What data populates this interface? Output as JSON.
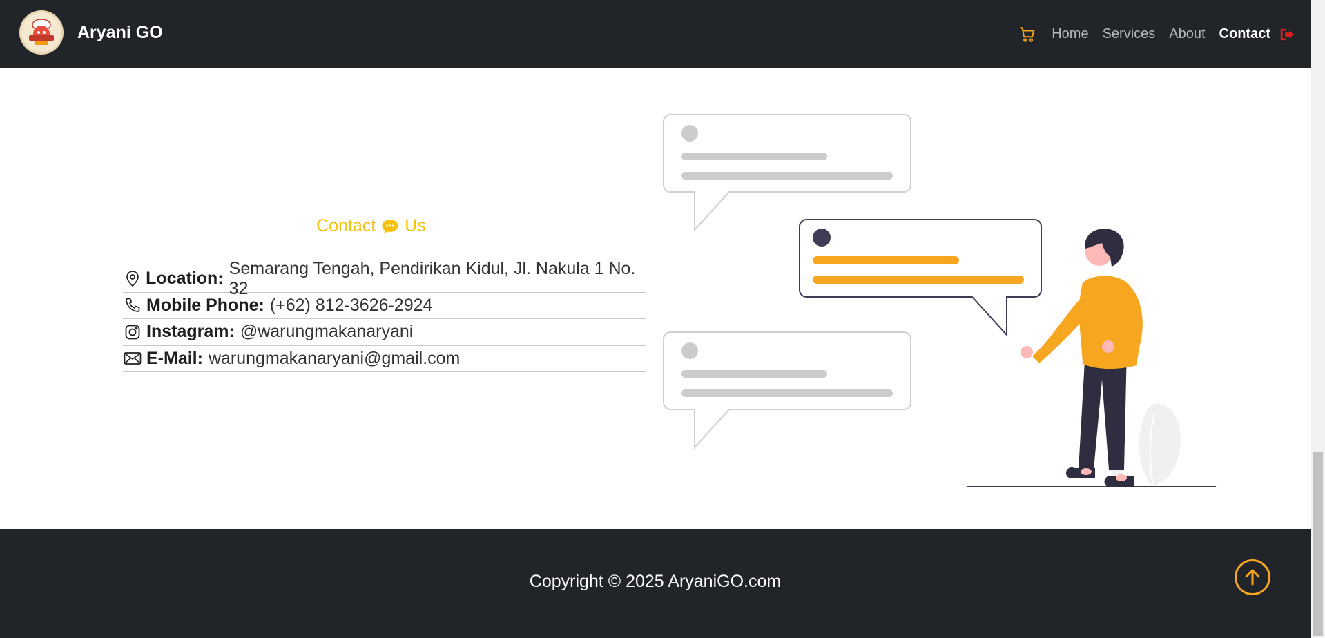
{
  "navbar": {
    "brand": "Aryani GO",
    "links": [
      {
        "label": "Home",
        "active": false
      },
      {
        "label": "Services",
        "active": false
      },
      {
        "label": "About",
        "active": false
      },
      {
        "label": "Contact",
        "active": true
      }
    ],
    "cart_icon": "shopping-cart-icon",
    "logout_icon": "sign-out-icon"
  },
  "contact": {
    "title_part1": "Contact",
    "title_icon": "speech-bubble-icon",
    "title_part2": "Us",
    "items": [
      {
        "icon": "map-pin-icon",
        "label": "Location:",
        "value": "Semarang Tengah, Pendirikan Kidul, Jl. Nakula 1 No. 32"
      },
      {
        "icon": "phone-icon",
        "label": "Mobile Phone:",
        "value": "(+62) 812-3626-2924"
      },
      {
        "icon": "instagram-icon",
        "label": "Instagram:",
        "value": "@warungmakanaryani"
      },
      {
        "icon": "envelope-icon",
        "label": "E-Mail:",
        "value": "warungmakanaryani@gmail.com"
      }
    ]
  },
  "footer": {
    "copyright": "Copyright © 2025 AryaniGO.com",
    "to_top_icon": "arrow-up-circle-icon"
  },
  "colors": {
    "nav_bg": "#212529",
    "accent_yellow": "#f6c10b",
    "accent_orange": "#f6a61f",
    "logout_red": "#e0201c"
  }
}
